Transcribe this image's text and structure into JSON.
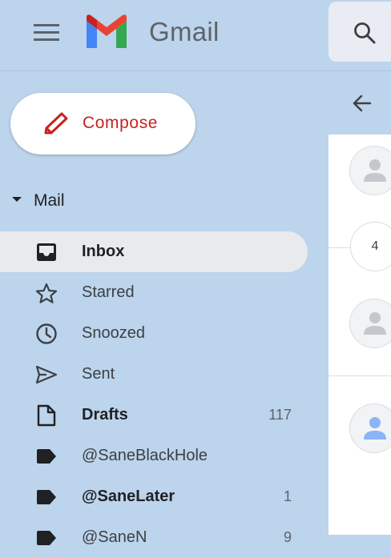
{
  "header": {
    "brand": "Gmail",
    "icons": {
      "menu": "menu-icon",
      "logo": "gmail-logo",
      "search": "search-icon"
    }
  },
  "compose": {
    "label": "Compose"
  },
  "section": {
    "label": "Mail"
  },
  "nav": [
    {
      "label": "Inbox",
      "count": "",
      "icon": "inbox-icon",
      "active": true,
      "bold": true
    },
    {
      "label": "Starred",
      "count": "",
      "icon": "star-icon"
    },
    {
      "label": "Snoozed",
      "count": "",
      "icon": "clock-icon"
    },
    {
      "label": "Sent",
      "count": "",
      "icon": "send-icon"
    },
    {
      "label": "Drafts",
      "count": "117",
      "icon": "draft-icon",
      "bold": true
    },
    {
      "label": "@SaneBlackHole",
      "count": "",
      "icon": "label-icon"
    },
    {
      "label": "@SaneLater",
      "count": "1",
      "icon": "label-icon",
      "bold": true
    },
    {
      "label": "@SaneN",
      "count": "9",
      "icon": "label-icon"
    }
  ],
  "thread": {
    "message_count": "4"
  },
  "colors": {
    "sidebar_bg": "#bcd4ec",
    "compose_text": "#c5221f",
    "active_item_bg": "#e8eaee",
    "avatar_accent": "#8ab4f8"
  }
}
